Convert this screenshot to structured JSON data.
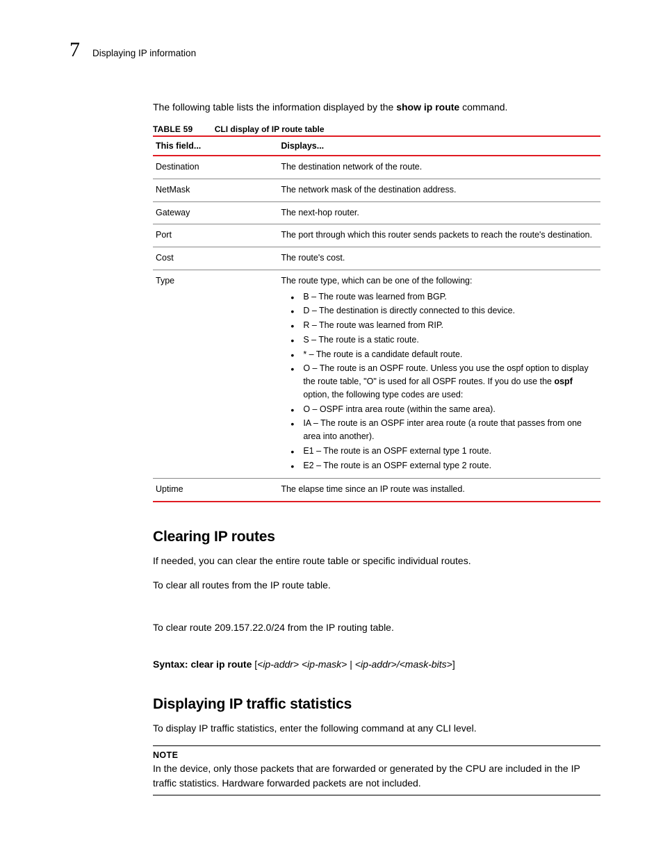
{
  "header": {
    "chapter_number": "7",
    "title": "Displaying IP information"
  },
  "intro": {
    "before_cmd": "The following table lists the information displayed by the ",
    "cmd": "show ip route",
    "after_cmd": " command."
  },
  "table": {
    "label": "TABLE 59",
    "name": "CLI display of IP route table",
    "head_field": "This field...",
    "head_displays": "Displays...",
    "rows": {
      "destination": {
        "field": "Destination",
        "disp": "The destination network of the route."
      },
      "netmask": {
        "field": "NetMask",
        "disp": "The network mask of the destination address."
      },
      "gateway": {
        "field": "Gateway",
        "disp": "The next-hop router."
      },
      "port": {
        "field": "Port",
        "disp": "The port through which this router sends packets to reach the route's destination."
      },
      "cost": {
        "field": "Cost",
        "disp": "The route's cost."
      },
      "type": {
        "field": "Type",
        "intro": "The route type, which can be one of the following:",
        "bullets": {
          "b": "B – The route was learned from BGP.",
          "d": "D – The destination is directly connected to this device.",
          "r": "R – The route was learned from RIP.",
          "s": "S – The route is a static route.",
          "star": "* – The route is a candidate default route.",
          "o_pre": "O – The route is an OSPF route.  Unless you use the ospf option to display the route table, \"O\" is used for all OSPF routes.  If you do use the ",
          "o_bold": "ospf",
          "o_post": " option, the following type codes are used:",
          "o2": "O – OSPF intra area route (within the same area).",
          "ia": "IA – The route is an OSPF inter area route (a route that passes from one area into another).",
          "e1": "E1 – The route is an OSPF external type 1 route.",
          "e2": "E2 – The route is an OSPF external type 2 route."
        }
      },
      "uptime": {
        "field": "Uptime",
        "disp": "The elapse time since an IP route was installed."
      }
    }
  },
  "clearing": {
    "title": "Clearing IP routes",
    "p1": "If needed, you can clear the entire route table or specific individual routes.",
    "p2": "To clear all routes from the IP route table.",
    "p3": "To clear route 209.157.22.0/24 from the IP routing table.",
    "syntax_label": "Syntax:  clear ip route",
    "syntax_rest_open": " [",
    "syntax_args": "<ip-addr> <ip-mask>",
    "syntax_pipe": " | ",
    "syntax_args2": "<ip-addr>/<mask-bits>",
    "syntax_close": "]"
  },
  "traffic": {
    "title": "Displaying IP traffic statistics",
    "p1": "To display IP traffic statistics, enter the following command at any CLI level.",
    "note_label": "NOTE",
    "note_text": "In the device, only those packets that are forwarded or generated by the CPU are included in the IP traffic statistics. Hardware forwarded packets are not included."
  }
}
